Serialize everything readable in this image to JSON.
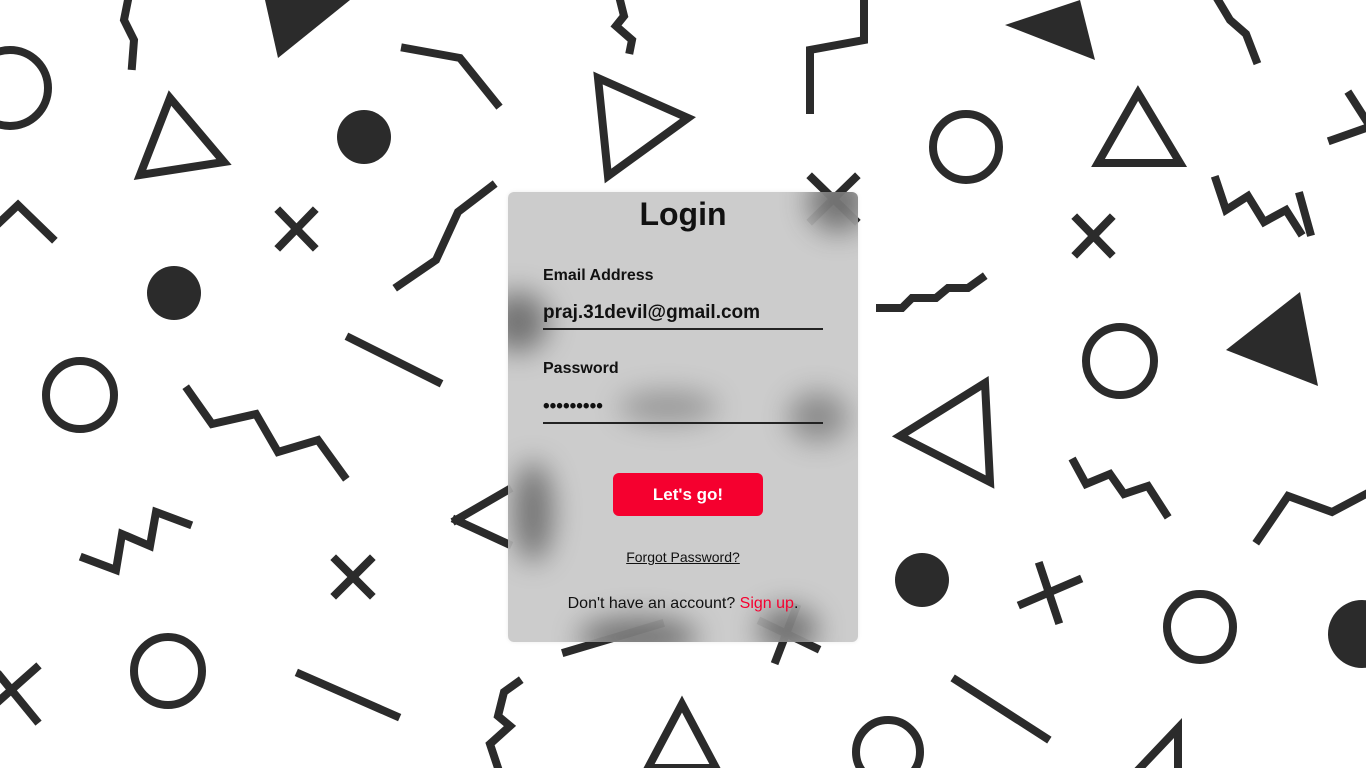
{
  "colors": {
    "background": "#ffffff",
    "shapes": "#2b2b2b",
    "accent": "#f5002f",
    "card": "#c8c8c8"
  },
  "login": {
    "title": "Login",
    "email_label": "Email Address",
    "email_value": "praj.31devil@gmail.com",
    "password_label": "Password",
    "password_value": "•••••••••",
    "submit_label": "Let's go!",
    "forgot_label": "Forgot Password?",
    "signup_prompt": "Don't have an account? ",
    "signup_link": "Sign up",
    "signup_suffix": "."
  }
}
